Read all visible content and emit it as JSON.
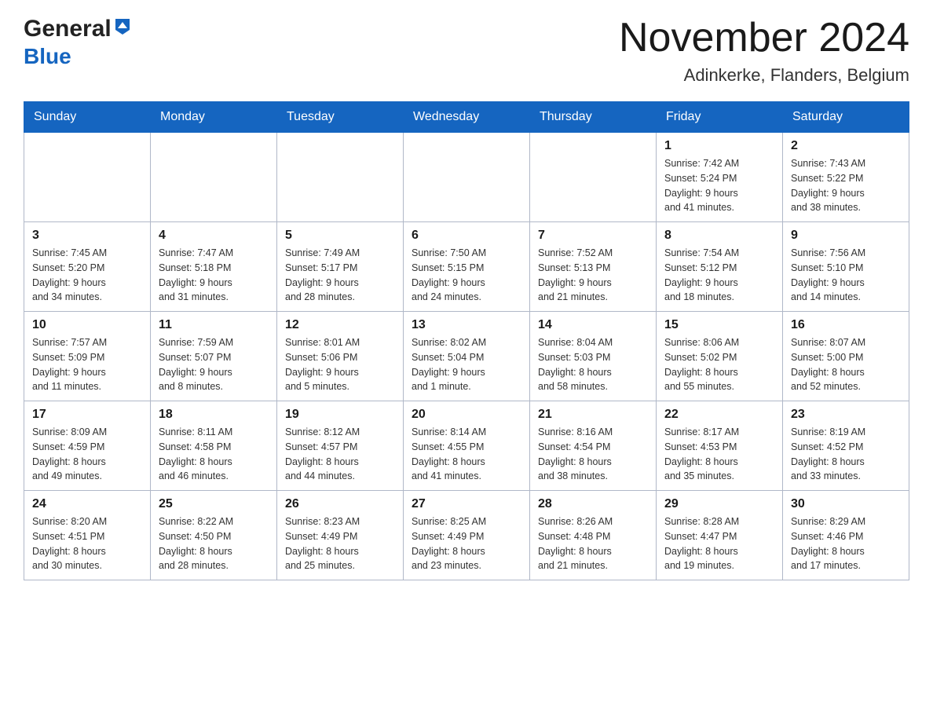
{
  "header": {
    "title": "November 2024",
    "subtitle": "Adinkerke, Flanders, Belgium",
    "logo_general": "General",
    "logo_blue": "Blue"
  },
  "weekdays": [
    "Sunday",
    "Monday",
    "Tuesday",
    "Wednesday",
    "Thursday",
    "Friday",
    "Saturday"
  ],
  "weeks": [
    [
      {
        "day": "",
        "info": ""
      },
      {
        "day": "",
        "info": ""
      },
      {
        "day": "",
        "info": ""
      },
      {
        "day": "",
        "info": ""
      },
      {
        "day": "",
        "info": ""
      },
      {
        "day": "1",
        "info": "Sunrise: 7:42 AM\nSunset: 5:24 PM\nDaylight: 9 hours\nand 41 minutes."
      },
      {
        "day": "2",
        "info": "Sunrise: 7:43 AM\nSunset: 5:22 PM\nDaylight: 9 hours\nand 38 minutes."
      }
    ],
    [
      {
        "day": "3",
        "info": "Sunrise: 7:45 AM\nSunset: 5:20 PM\nDaylight: 9 hours\nand 34 minutes."
      },
      {
        "day": "4",
        "info": "Sunrise: 7:47 AM\nSunset: 5:18 PM\nDaylight: 9 hours\nand 31 minutes."
      },
      {
        "day": "5",
        "info": "Sunrise: 7:49 AM\nSunset: 5:17 PM\nDaylight: 9 hours\nand 28 minutes."
      },
      {
        "day": "6",
        "info": "Sunrise: 7:50 AM\nSunset: 5:15 PM\nDaylight: 9 hours\nand 24 minutes."
      },
      {
        "day": "7",
        "info": "Sunrise: 7:52 AM\nSunset: 5:13 PM\nDaylight: 9 hours\nand 21 minutes."
      },
      {
        "day": "8",
        "info": "Sunrise: 7:54 AM\nSunset: 5:12 PM\nDaylight: 9 hours\nand 18 minutes."
      },
      {
        "day": "9",
        "info": "Sunrise: 7:56 AM\nSunset: 5:10 PM\nDaylight: 9 hours\nand 14 minutes."
      }
    ],
    [
      {
        "day": "10",
        "info": "Sunrise: 7:57 AM\nSunset: 5:09 PM\nDaylight: 9 hours\nand 11 minutes."
      },
      {
        "day": "11",
        "info": "Sunrise: 7:59 AM\nSunset: 5:07 PM\nDaylight: 9 hours\nand 8 minutes."
      },
      {
        "day": "12",
        "info": "Sunrise: 8:01 AM\nSunset: 5:06 PM\nDaylight: 9 hours\nand 5 minutes."
      },
      {
        "day": "13",
        "info": "Sunrise: 8:02 AM\nSunset: 5:04 PM\nDaylight: 9 hours\nand 1 minute."
      },
      {
        "day": "14",
        "info": "Sunrise: 8:04 AM\nSunset: 5:03 PM\nDaylight: 8 hours\nand 58 minutes."
      },
      {
        "day": "15",
        "info": "Sunrise: 8:06 AM\nSunset: 5:02 PM\nDaylight: 8 hours\nand 55 minutes."
      },
      {
        "day": "16",
        "info": "Sunrise: 8:07 AM\nSunset: 5:00 PM\nDaylight: 8 hours\nand 52 minutes."
      }
    ],
    [
      {
        "day": "17",
        "info": "Sunrise: 8:09 AM\nSunset: 4:59 PM\nDaylight: 8 hours\nand 49 minutes."
      },
      {
        "day": "18",
        "info": "Sunrise: 8:11 AM\nSunset: 4:58 PM\nDaylight: 8 hours\nand 46 minutes."
      },
      {
        "day": "19",
        "info": "Sunrise: 8:12 AM\nSunset: 4:57 PM\nDaylight: 8 hours\nand 44 minutes."
      },
      {
        "day": "20",
        "info": "Sunrise: 8:14 AM\nSunset: 4:55 PM\nDaylight: 8 hours\nand 41 minutes."
      },
      {
        "day": "21",
        "info": "Sunrise: 8:16 AM\nSunset: 4:54 PM\nDaylight: 8 hours\nand 38 minutes."
      },
      {
        "day": "22",
        "info": "Sunrise: 8:17 AM\nSunset: 4:53 PM\nDaylight: 8 hours\nand 35 minutes."
      },
      {
        "day": "23",
        "info": "Sunrise: 8:19 AM\nSunset: 4:52 PM\nDaylight: 8 hours\nand 33 minutes."
      }
    ],
    [
      {
        "day": "24",
        "info": "Sunrise: 8:20 AM\nSunset: 4:51 PM\nDaylight: 8 hours\nand 30 minutes."
      },
      {
        "day": "25",
        "info": "Sunrise: 8:22 AM\nSunset: 4:50 PM\nDaylight: 8 hours\nand 28 minutes."
      },
      {
        "day": "26",
        "info": "Sunrise: 8:23 AM\nSunset: 4:49 PM\nDaylight: 8 hours\nand 25 minutes."
      },
      {
        "day": "27",
        "info": "Sunrise: 8:25 AM\nSunset: 4:49 PM\nDaylight: 8 hours\nand 23 minutes."
      },
      {
        "day": "28",
        "info": "Sunrise: 8:26 AM\nSunset: 4:48 PM\nDaylight: 8 hours\nand 21 minutes."
      },
      {
        "day": "29",
        "info": "Sunrise: 8:28 AM\nSunset: 4:47 PM\nDaylight: 8 hours\nand 19 minutes."
      },
      {
        "day": "30",
        "info": "Sunrise: 8:29 AM\nSunset: 4:46 PM\nDaylight: 8 hours\nand 17 minutes."
      }
    ]
  ]
}
